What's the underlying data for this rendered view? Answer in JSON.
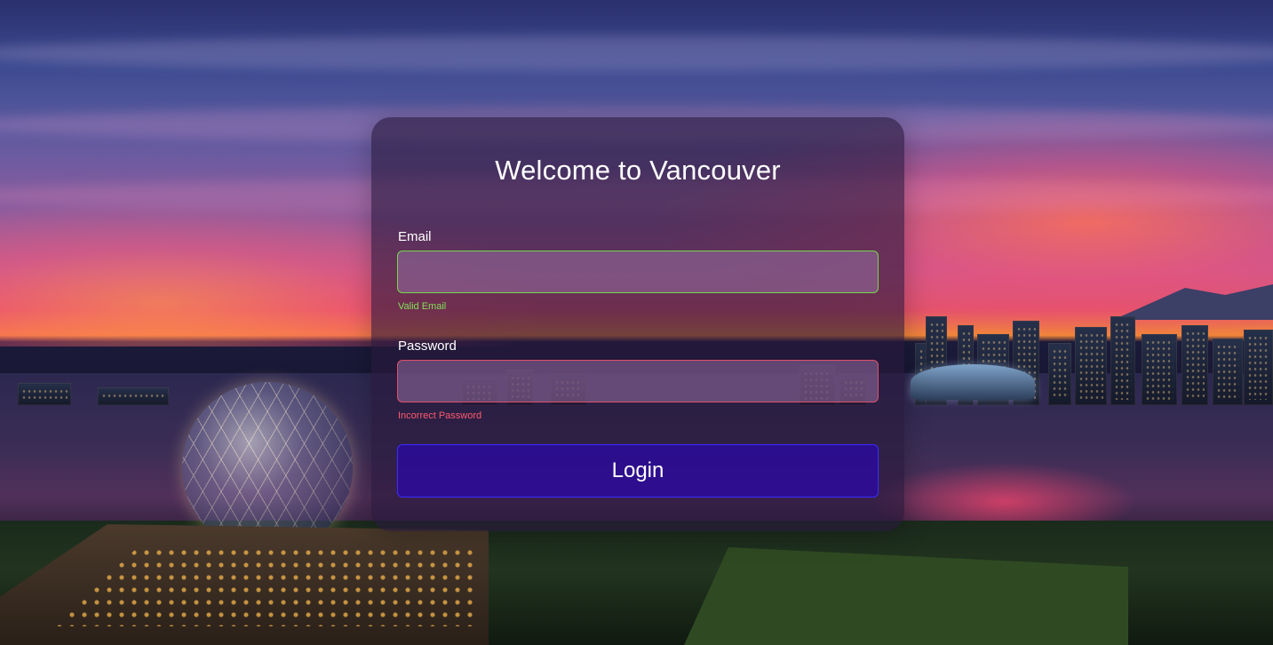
{
  "background": {
    "description_icon": "vancouver-sunset-photo-icon"
  },
  "card": {
    "title": "Welcome to Vancouver",
    "email": {
      "label": "Email",
      "value": "",
      "feedback": "Valid Email",
      "border_color": "#74d84a"
    },
    "password": {
      "label": "Password",
      "value": "",
      "feedback": "Incorrect Password",
      "border_color": "#e0506a"
    },
    "login_label": "Login",
    "button_color": "#2800c8"
  },
  "colors": {
    "valid": "#7fe05a",
    "invalid": "#ff5a6e"
  }
}
